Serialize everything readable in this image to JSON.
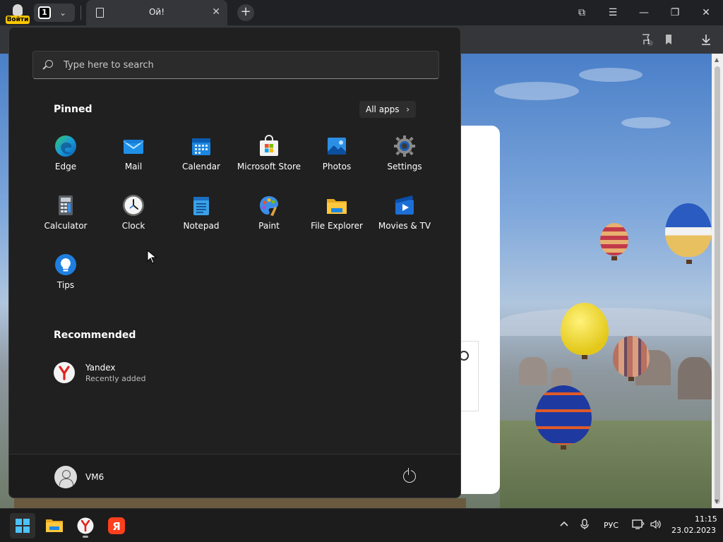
{
  "browser": {
    "profile_label": "Войти",
    "tab_count": "1",
    "tab_title": "Ой!",
    "new_tab": "+",
    "close_tab": "✕",
    "window_buttons": [
      "⧉",
      "☰",
      "—",
      "❐",
      "✕"
    ],
    "toolbar_badge": "1"
  },
  "start_menu": {
    "search_placeholder": "Type here to search",
    "pinned_title": "Pinned",
    "all_apps_label": "All apps",
    "pinned_apps": [
      {
        "label": "Edge",
        "icon": "edge-icon"
      },
      {
        "label": "Mail",
        "icon": "mail-icon"
      },
      {
        "label": "Calendar",
        "icon": "calendar-icon"
      },
      {
        "label": "Microsoft Store",
        "icon": "store-icon"
      },
      {
        "label": "Photos",
        "icon": "photos-icon"
      },
      {
        "label": "Settings",
        "icon": "settings-icon"
      },
      {
        "label": "Calculator",
        "icon": "calculator-icon"
      },
      {
        "label": "Clock",
        "icon": "clock-icon"
      },
      {
        "label": "Notepad",
        "icon": "notepad-icon"
      },
      {
        "label": "Paint",
        "icon": "paint-icon"
      },
      {
        "label": "File Explorer",
        "icon": "folder-icon"
      },
      {
        "label": "Movies & TV",
        "icon": "movies-icon"
      },
      {
        "label": "Tips",
        "icon": "tips-icon"
      }
    ],
    "recommended_title": "Recommended",
    "recommended": [
      {
        "name": "Yandex",
        "subtitle": "Recently added",
        "icon": "yandex-browser-icon"
      }
    ],
    "user_name": "VM6"
  },
  "taskbar": {
    "language": "РУС",
    "time": "11:15",
    "date": "23.02.2023"
  },
  "colors": {
    "accent": "#4cc2ff",
    "yandex_red": "#fc3f1d",
    "start_bg": "#202020",
    "profile_badge": "#f7c600"
  }
}
